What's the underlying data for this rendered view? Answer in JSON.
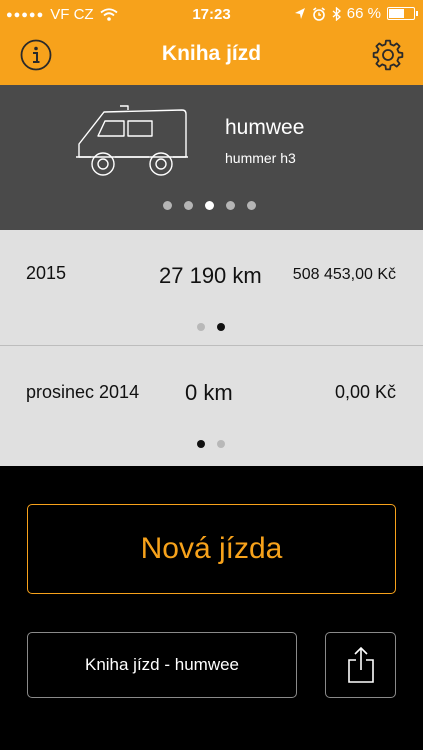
{
  "status_bar": {
    "carrier": "VF CZ",
    "time": "17:23",
    "battery_text": "66 %",
    "battery_level": 0.66,
    "icons": [
      "signal-dots-icon",
      "wifi-icon",
      "location-icon",
      "alarm-icon",
      "bluetooth-icon",
      "battery-icon"
    ]
  },
  "nav": {
    "title": "Kniha jízd",
    "left_icon": "info-icon",
    "right_icon": "gear-icon"
  },
  "vehicle": {
    "icon": "van-icon",
    "name": "humwee",
    "model": "hummer h3",
    "pager": {
      "count": 5,
      "active": 2
    }
  },
  "stats": [
    {
      "period": "2015",
      "distance": "27 190 km",
      "cost": "508 453,00 Kč",
      "pager": {
        "count": 2,
        "active": 1
      }
    },
    {
      "period": "prosinec 2014",
      "distance": "0 km",
      "cost": "0,00 Kč",
      "pager": {
        "count": 2,
        "active": 0
      }
    }
  ],
  "actions": {
    "new_trip": "Nová jízda",
    "logbook": "Kniha jízd - humwee",
    "share_icon": "share-icon"
  },
  "colors": {
    "accent": "#f7a21b",
    "vehicle_bg": "#4a4a4a",
    "stats_bg": "#e0e0e0",
    "background": "#000000"
  }
}
